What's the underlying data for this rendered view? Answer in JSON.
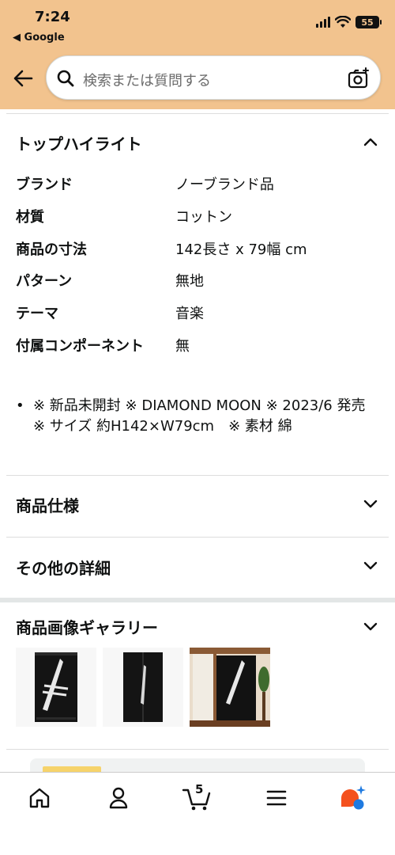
{
  "status_bar": {
    "time": "7:24",
    "back_app": "◀ Google",
    "battery": "55"
  },
  "search": {
    "placeholder": "検索または質問する"
  },
  "top_highlights": {
    "title": "トップハイライト",
    "specs": [
      {
        "label": "ブランド",
        "value": "ノーブランド品"
      },
      {
        "label": "材質",
        "value": "コットン"
      },
      {
        "label": "商品の寸法",
        "value": "142長さ x 79幅 cm"
      },
      {
        "label": "パターン",
        "value": "無地"
      },
      {
        "label": "テーマ",
        "value": "音楽"
      },
      {
        "label": "付属コンポーネント",
        "value": "無"
      }
    ],
    "bullet": "※ 新品未開封 ※ DIAMOND MOON ※ 2023/6 発売 ※ サイズ 約H142×W79cm　※ 素材 綿"
  },
  "sections": {
    "specs_title": "商品仕様",
    "details_title": "その他の詳細",
    "gallery_title": "商品画像ギャラリー"
  },
  "tabbar": {
    "cart_count": "5"
  },
  "colors": {
    "header_bg": "#f2c38e",
    "text": "#0f1111",
    "tab_active": "#f4511e"
  },
  "icons": [
    "back-arrow-icon",
    "search-icon",
    "camera-icon",
    "chevron-up-icon",
    "chevron-down-icon",
    "home-icon",
    "account-icon",
    "cart-icon",
    "menu-icon",
    "rufus-ai-icon"
  ]
}
